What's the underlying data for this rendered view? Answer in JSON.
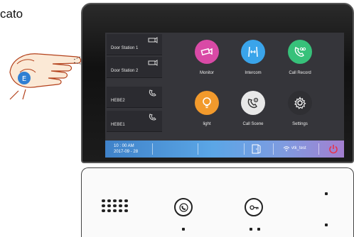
{
  "corner_text": "cato",
  "sidebar": {
    "items": [
      {
        "label": "Door Station 1",
        "icon": "camera-icon"
      },
      {
        "label": "Door Station 2",
        "icon": "camera-icon"
      },
      {
        "label": "HEBE2",
        "icon": "phone-icon"
      },
      {
        "label": "HEBE1",
        "icon": "phone-icon"
      }
    ]
  },
  "tiles": [
    {
      "label": "Monitor",
      "icon": "camera-icon",
      "color": "#d94aa6"
    },
    {
      "label": "Intercom",
      "icon": "intercom-icon",
      "color": "#3aa4ea"
    },
    {
      "label": "Call Record",
      "icon": "voicemail-icon",
      "color": "#37c17a"
    },
    {
      "label": "light",
      "icon": "bulb-icon",
      "color": "#f29a2c"
    },
    {
      "label": "Call Scene",
      "icon": "call-settings-icon",
      "color": "#e8e8e8"
    },
    {
      "label": "Settings",
      "icon": "gear-icon",
      "color": "#2f2f33"
    }
  ],
  "status_bar": {
    "time": "10 : 00 AM",
    "date": "2017-09 - 28",
    "wifi_name": "vtk_test",
    "accent_power": "#e8334a"
  }
}
